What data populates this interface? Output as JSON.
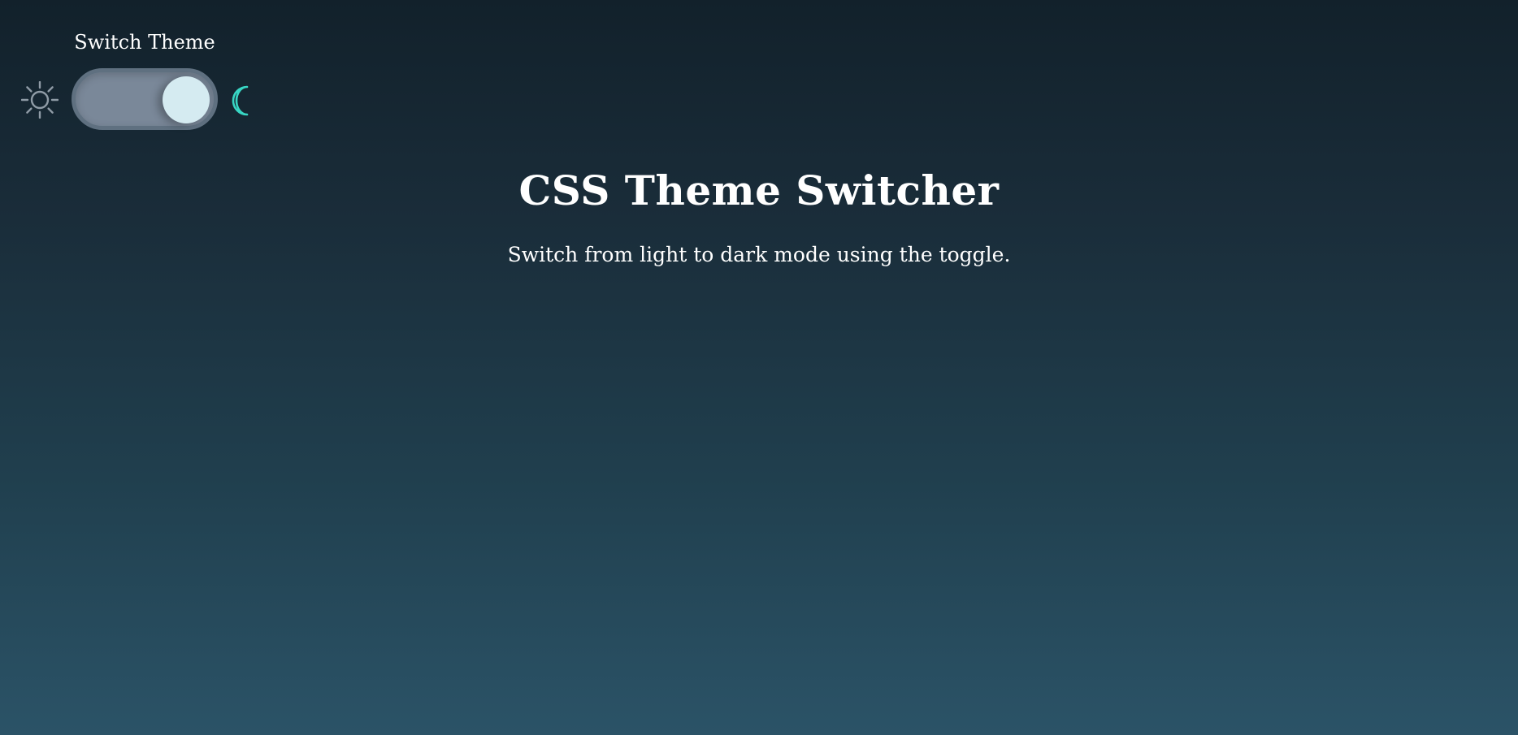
{
  "theme_switch": {
    "label": "Switch Theme",
    "state": "dark",
    "left_icon": "sun-icon",
    "right_icon": "moon-icon",
    "track_color": "#7a8899",
    "knob_color": "#d5ebf1",
    "moon_color": "#38d6c4",
    "sun_color": "#8f9ba6"
  },
  "main": {
    "title": "CSS Theme Switcher",
    "subtitle": "Switch from light to dark mode using the toggle."
  }
}
